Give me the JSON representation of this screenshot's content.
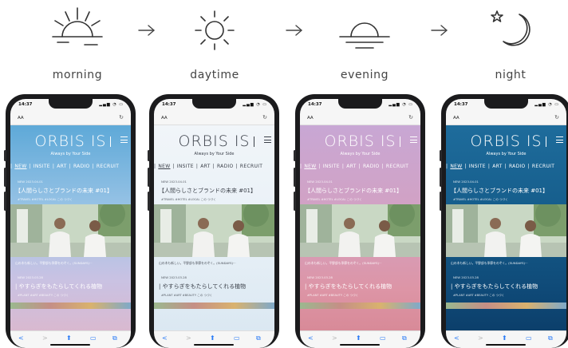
{
  "periods": [
    {
      "label": "morning",
      "icon": "sunrise-icon"
    },
    {
      "label": "daytime",
      "icon": "sun-icon"
    },
    {
      "label": "evening",
      "icon": "sunset-icon"
    },
    {
      "label": "night",
      "icon": "moon-star-icon"
    }
  ],
  "arrows": [
    "arrow-right-icon",
    "arrow-right-icon",
    "arrow-right-icon"
  ],
  "phone": {
    "time": "14:37",
    "status_icons": "▂▄▆ ◔ ▭",
    "aa": "AA",
    "reload": "↻",
    "logo": "ORBIS IS",
    "tagline": "Always by Your Side",
    "nav": [
      "NEW",
      "INSITE",
      "ART",
      "RADIO",
      "RECRUIT"
    ],
    "article1": {
      "date": "NEW 2023.04.01",
      "title": "【人間らしさとブランドの未来 #01】",
      "tags": "#TRAVEL #HOTEL #LOCAL この つづく"
    },
    "article2": {
      "caption": "山の木も新しい。平野部も季節をのぞく。(SUNDAYS)···",
      "date": "NEW 2023.03.28",
      "title": "| やすらぎをもたらしてくれる植物",
      "tags": "#PLANT #ART #BEAUTY この つづく"
    },
    "toolbar": {
      "back": "<",
      "forward": ">",
      "share": "⬆",
      "bookmarks": "▭",
      "tabs": "⧉"
    }
  },
  "colors": {
    "morning": "#5ea9d8",
    "daytime": "#eef3f8",
    "evening": "#d3a1c2",
    "night": "#155c8a",
    "safari_blue": "#2a7bf6"
  }
}
